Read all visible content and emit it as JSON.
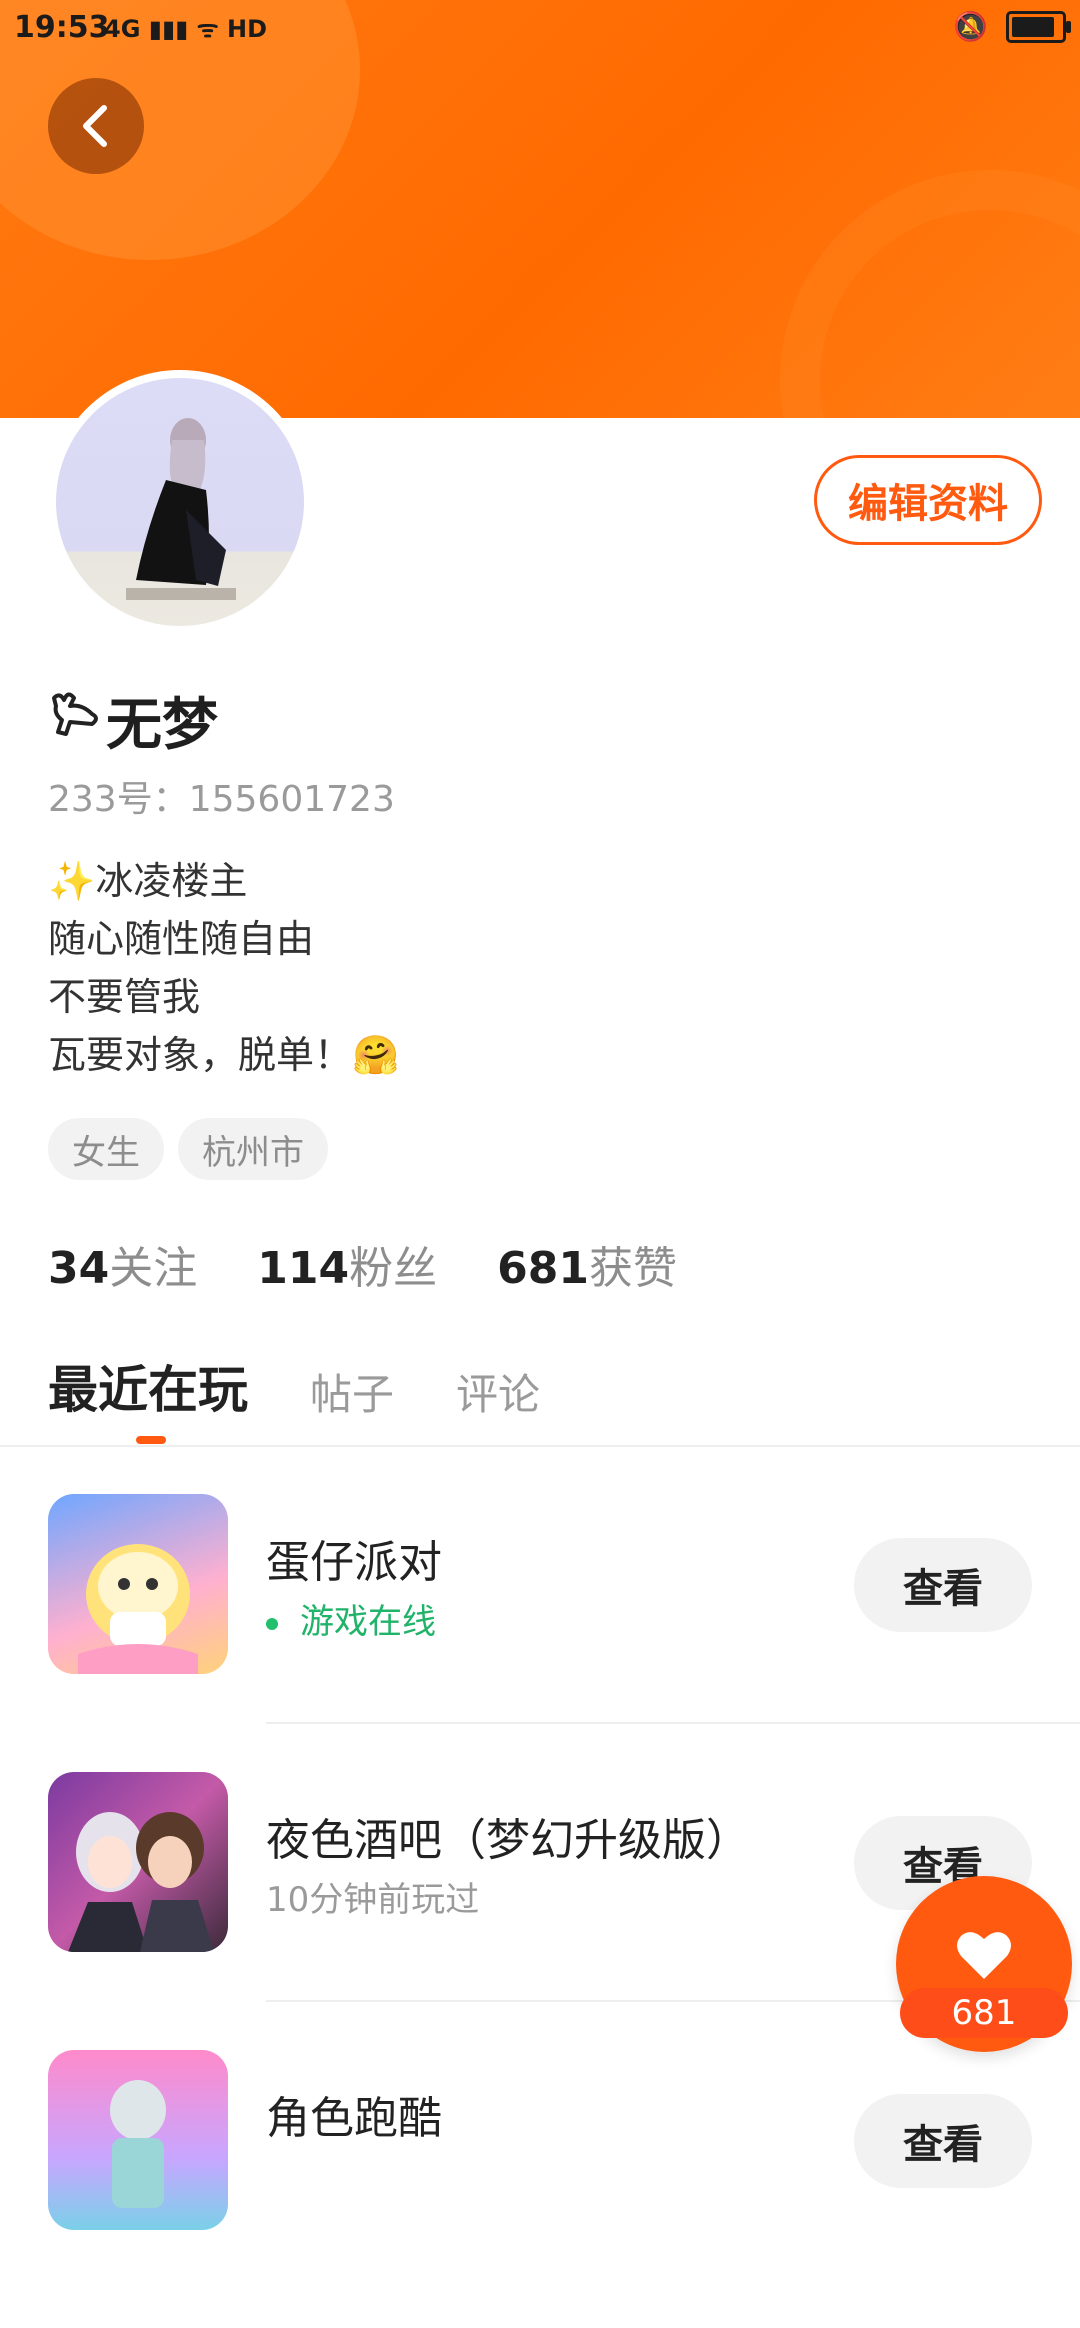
{
  "status_bar": {
    "time": "19:53",
    "signal": "4G",
    "network": "HD"
  },
  "profile": {
    "edit_label": "编辑资料",
    "name_prefix": "𐂃",
    "name": "无梦",
    "id_text": "233号：155601723",
    "bio_lines": [
      "✨冰凌楼主",
      "随心随性随自由",
      "不要管我",
      "瓦要对象，脱单！🤗"
    ],
    "tags": [
      "女生",
      "杭州市"
    ],
    "stats": [
      {
        "count": "34",
        "label": "关注"
      },
      {
        "count": "114",
        "label": "粉丝"
      },
      {
        "count": "681",
        "label": "获赞"
      }
    ]
  },
  "tabs": [
    "最近在玩",
    "帖子",
    "评论"
  ],
  "games": [
    {
      "title": "蛋仔派对",
      "status": "游戏在线",
      "view_label": "查看"
    },
    {
      "title": "夜色酒吧（梦幻升级版）",
      "status": "10分钟前玩过",
      "view_label": "查看"
    },
    {
      "title": "角色跑酷",
      "status": "",
      "view_label": "查看"
    }
  ],
  "like_button": {
    "count": "681"
  },
  "colors": {
    "accent": "#ff5a10",
    "header": "#ff6a00",
    "online": "#22b36a"
  }
}
